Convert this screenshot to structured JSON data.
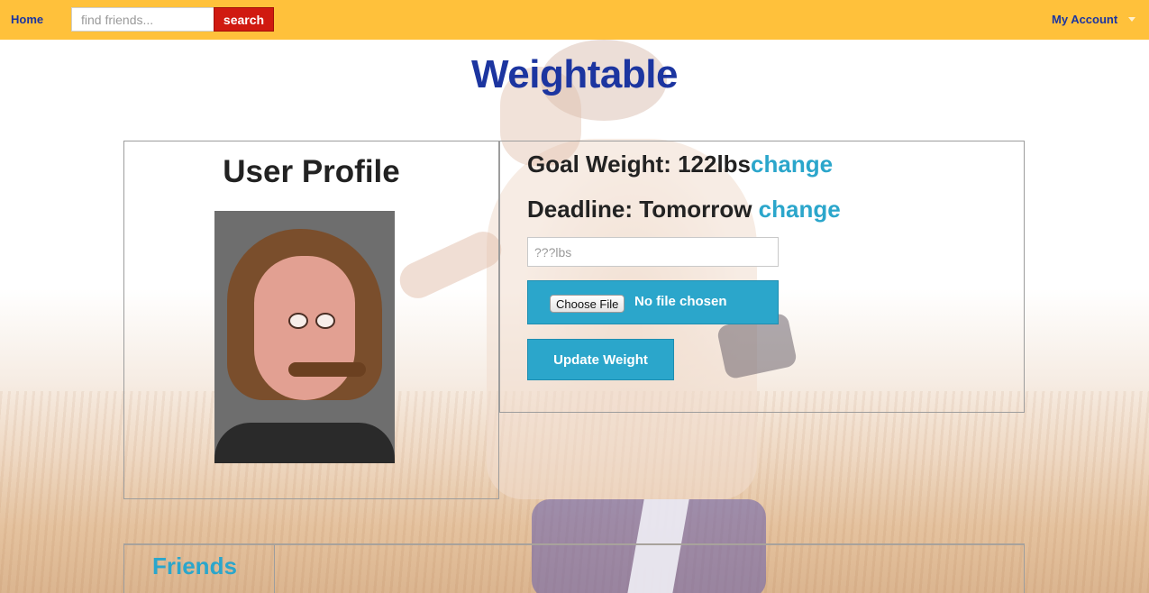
{
  "nav": {
    "home_label": "Home",
    "search_placeholder": "find friends...",
    "search_button": "search",
    "account_label": "My Account"
  },
  "site_title": "Weightable",
  "profile": {
    "heading": "User Profile"
  },
  "weight": {
    "goal_label": "Goal Weight: 122lbs",
    "goal_change": "change",
    "deadline_label": "Deadline: Tomorrow ",
    "deadline_change": "change",
    "input_placeholder": "???lbs",
    "choose_file_label": "Choose File",
    "file_status": "No file chosen",
    "update_button": "Update Weight"
  },
  "friends": {
    "heading": "Friends"
  },
  "colors": {
    "topbar": "#ffc13b",
    "title": "#1c35a0",
    "accent": "#2ba6cb",
    "search_button": "#d01a10"
  }
}
